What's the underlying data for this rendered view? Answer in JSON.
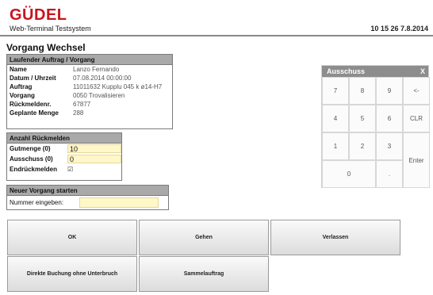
{
  "header": {
    "brand": "GÜDEL",
    "subtitle": "Web-Terminal  Testsystem",
    "clock": "10  15  26   7.8.2014"
  },
  "page_title": "Vorgang Wechsel",
  "auftrag": {
    "title": "Laufender Auftrag / Vorgang",
    "rows": [
      {
        "label": "Name",
        "value": "Lanzo  Fernando"
      },
      {
        "label": "Datum / Uhrzeit",
        "value": "07.08.2014  00:00:00"
      },
      {
        "label": "Auftrag",
        "value": "11011632  Kupplu  045  k  ø14-H7"
      },
      {
        "label": "Vorgang",
        "value": "0050  Trovalisieren"
      },
      {
        "label": "Rückmeldenr.",
        "value": "67877"
      },
      {
        "label": "Geplante  Menge",
        "value": "288"
      }
    ]
  },
  "rueckmelden": {
    "title": "Anzahl  Rückmelden",
    "gutmenge_label": "Gutmenge (0)",
    "gutmenge_value": "10",
    "ausschuss_label": "Ausschuss (0)",
    "ausschuss_value": "0",
    "endrueck_label": "Endrückmelden",
    "endrueck_check": "☑"
  },
  "neuer": {
    "title": "Neuer  Vorgang  starten",
    "label": "Nummer  eingeben:",
    "value": ""
  },
  "keypad": {
    "title": "Ausschuss",
    "close": "X",
    "keys": [
      "7",
      "8",
      "9",
      "<-",
      "4",
      "5",
      "6",
      "CLR",
      "1",
      "2",
      "3",
      "Enter",
      "0",
      "."
    ]
  },
  "buttons": {
    "ok": "OK",
    "gehen": "Gehen",
    "verlassen": "Verlassen",
    "direkte": "Direkte  Buchung  ohne  Unterbruch",
    "sammel": "Sammelauftrag"
  }
}
